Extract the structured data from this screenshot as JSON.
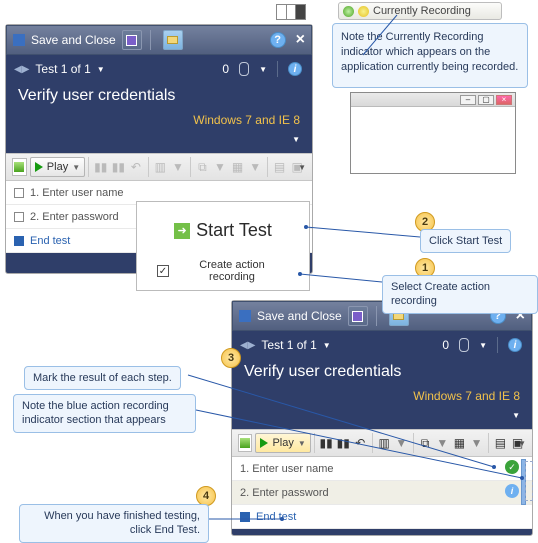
{
  "banner": {
    "label": "Currently Recording"
  },
  "note": "Note the Currently Recording indicator which appears on the application currently being recorded.",
  "window1": {
    "saveClose": "Save and Close",
    "testNav": "Test 1 of 1",
    "attachCount": "0",
    "title": "Verify user credentials",
    "config": "Windows 7 and IE 8",
    "playLabel": "Play",
    "steps": {
      "s1": "1. Enter user name",
      "s2": "2. Enter password",
      "end": "End test"
    }
  },
  "popup": {
    "start": "Start Test",
    "checkbox": "Create action recording",
    "checked": true
  },
  "window2": {
    "saveClose": "Save and Close",
    "testNav": "Test 1 of 1",
    "attachCount": "0",
    "title": "Verify user credentials",
    "config": "Windows 7 and IE 8",
    "playLabel": "Play",
    "steps": {
      "s1": "1. Enter user name",
      "s2": "2. Enter password",
      "end": "End test"
    }
  },
  "callouts": {
    "c1": "Select Create action recording",
    "c2": "Click Start Test",
    "c3": "Mark the result of each step.",
    "c4a": "Note the blue action recording",
    "c4b": "indicator section that appears",
    "c5a": "When you have finished testing,",
    "c5b": "click End Test."
  },
  "badges": {
    "b1": "1",
    "b2": "2",
    "b3": "3",
    "b4": "4"
  }
}
